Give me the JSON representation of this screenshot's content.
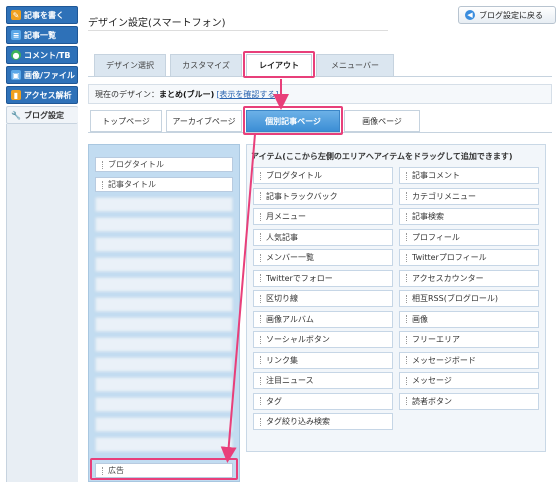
{
  "sidebar": {
    "items": [
      {
        "label": "記事を書く",
        "icon": "pencil-icon",
        "color": "#f0a020"
      },
      {
        "label": "記事一覧",
        "icon": "list-icon",
        "color": "#5aa7e8"
      },
      {
        "label": "コメント/TB",
        "icon": "comment-icon",
        "color": "#3cb35a"
      },
      {
        "label": "画像/ファイル",
        "icon": "image-icon",
        "color": "#5aa7e8"
      },
      {
        "label": "アクセス解析",
        "icon": "chart-icon",
        "color": "#f0a020"
      },
      {
        "label": "ブログ設定",
        "icon": "wrench-icon",
        "color": "#e83f7a"
      }
    ]
  },
  "header": {
    "title": "デザイン設定(スマートフォン)",
    "back_button": "ブログ設定に戻る"
  },
  "tabs": [
    "デザイン選択",
    "カスタマイズ",
    "レイアウト",
    "メニューバー"
  ],
  "design_bar": {
    "label": "現在のデザイン：",
    "value": "まとめ(ブルー)",
    "link": "[表示を確認する]"
  },
  "subtabs": [
    "トップページ",
    "アーカイブページ",
    "個別記事ページ",
    "画像ページ"
  ],
  "layout": {
    "visible_items": [
      "ブログタイトル",
      "記事タイトル"
    ],
    "bottom_item": "広告"
  },
  "items_panel": {
    "heading": "アイテム(ここから左側のエリアへアイテムをドラッグして追加できます)",
    "left": [
      "ブログタイトル",
      "記事トラックバック",
      "月メニュー",
      "人気記事",
      "メンバー一覧",
      "Twitterでフォロー",
      "区切り線",
      "画像アルバム",
      "ソーシャルボタン",
      "リンク集",
      "注目ニュース",
      "タグ",
      "タグ絞り込み検索"
    ],
    "right": [
      "記事コメント",
      "カテゴリメニュー",
      "記事検索",
      "プロフィール",
      "Twitterプロフィール",
      "アクセスカウンター",
      "相互RSS(ブログロール)",
      "画像",
      "フリーエリア",
      "メッセージボード",
      "メッセージ",
      "読者ボタン"
    ]
  },
  "colors": {
    "accent": "#e83f7a",
    "nav_blue": "#2e71b8",
    "active_tab": "#3c8ed5"
  }
}
